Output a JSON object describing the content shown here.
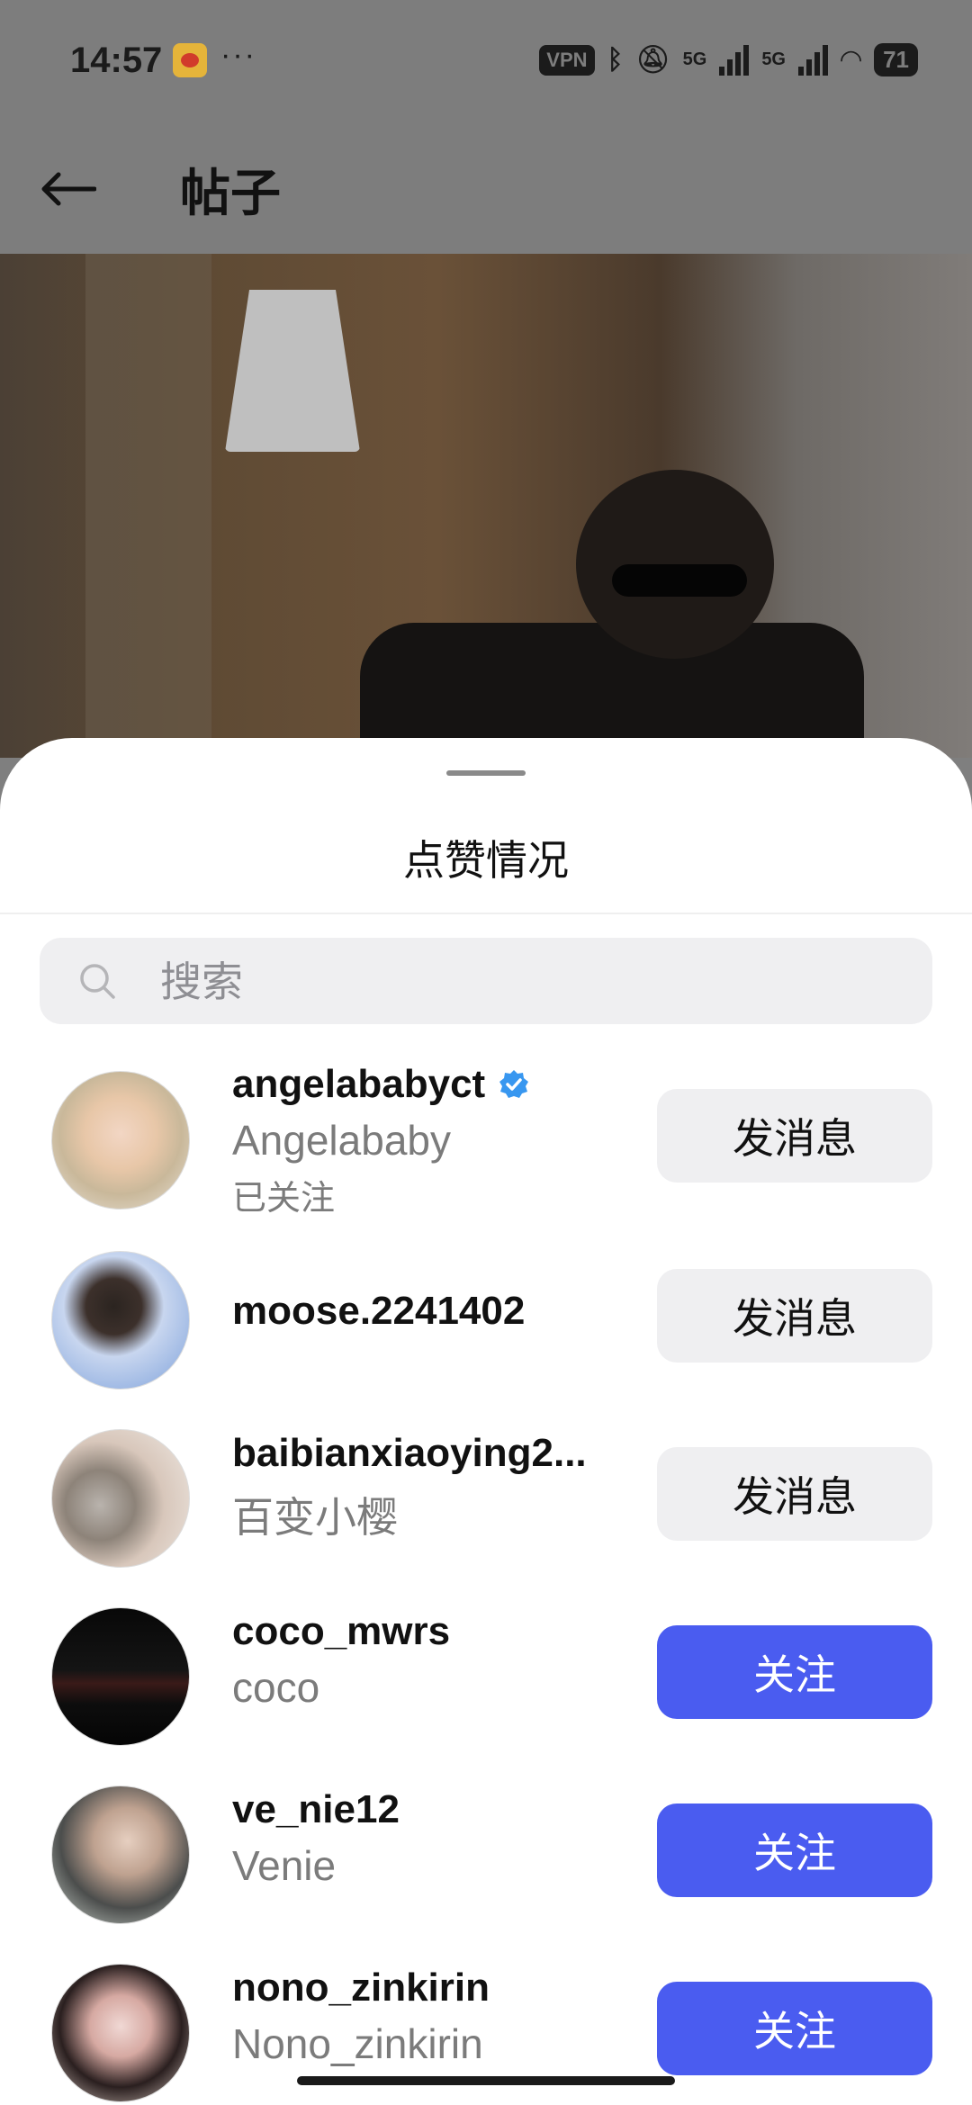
{
  "status_bar": {
    "time": "14:57",
    "dots": "···",
    "vpn": "VPN",
    "network_1": "5G",
    "network_2": "5G",
    "battery": "71"
  },
  "header": {
    "title": "帖子",
    "back_icon": "arrow-left-icon"
  },
  "sheet": {
    "title": "点赞情况",
    "search_placeholder": "搜索"
  },
  "users": [
    {
      "username": "angelababyct",
      "verified": true,
      "full_name": "Angelababy",
      "status": "已关注",
      "action": "发消息",
      "action_type": "message"
    },
    {
      "username": "moose.2241402",
      "verified": false,
      "full_name": "",
      "status": "",
      "action": "发消息",
      "action_type": "message"
    },
    {
      "username": "baibianxiaoying2...",
      "verified": false,
      "full_name": "百变小樱",
      "status": "",
      "action": "发消息",
      "action_type": "message"
    },
    {
      "username": "coco_mwrs",
      "verified": false,
      "full_name": "coco",
      "status": "",
      "action": "关注",
      "action_type": "follow"
    },
    {
      "username": "ve_nie12",
      "verified": false,
      "full_name": "Venie",
      "status": "",
      "action": "关注",
      "action_type": "follow"
    },
    {
      "username": "nono_zinkirin",
      "verified": false,
      "full_name": "Nono_zinkirin",
      "status": "",
      "action": "关注",
      "action_type": "follow"
    }
  ],
  "colors": {
    "follow_button": "#4a5cf0",
    "message_button": "#efeff1",
    "verified_badge": "#3897f0"
  }
}
